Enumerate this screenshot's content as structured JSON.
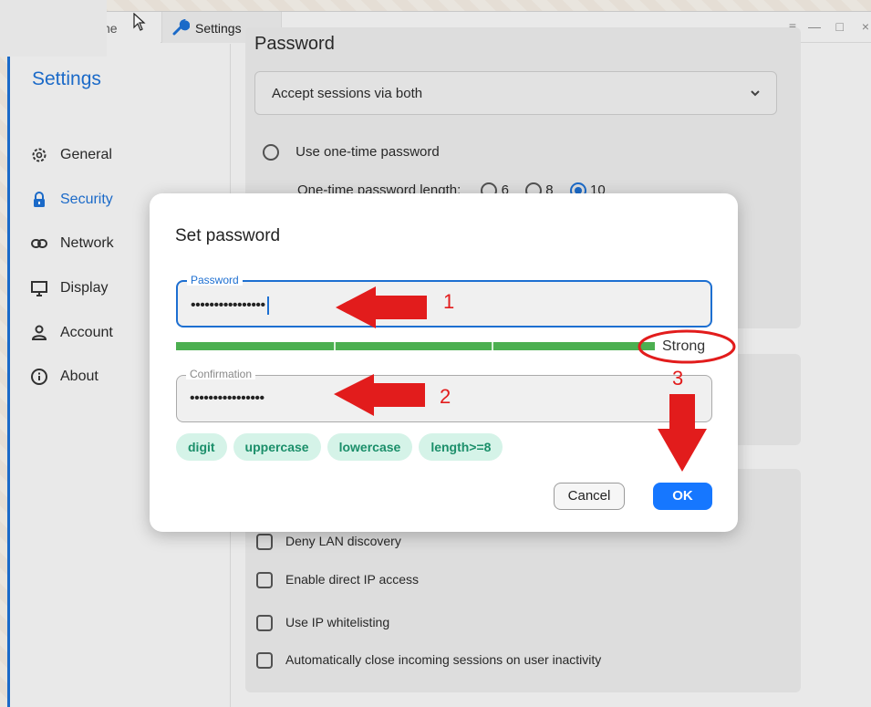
{
  "titlebar": {
    "prev_tab_label": "ne",
    "tab_label": "Settings",
    "controls": {
      "menu": "≡",
      "minimize": "—",
      "maximize": "□",
      "close": "×"
    }
  },
  "sidebar": {
    "title": "Settings",
    "items": [
      {
        "label": "General",
        "icon": "gear-icon"
      },
      {
        "label": "Security",
        "icon": "lock-icon"
      },
      {
        "label": "Network",
        "icon": "link-icon"
      },
      {
        "label": "Display",
        "icon": "monitor-icon"
      },
      {
        "label": "Account",
        "icon": "person-icon"
      },
      {
        "label": "About",
        "icon": "info-icon"
      }
    ],
    "active": "Security"
  },
  "main": {
    "password_section_title": "Password",
    "sessions_select": "Accept sessions via both",
    "use_otp_label": "Use one-time password",
    "otp_length_label": "One-time password length:",
    "otp_options": [
      "6",
      "8",
      "10"
    ],
    "otp_selected": "10",
    "checkboxes": [
      "Deny LAN discovery",
      "Enable direct IP access",
      "Use IP whitelisting",
      "Automatically close incoming sessions on user inactivity"
    ]
  },
  "dialog": {
    "title": "Set password",
    "password_legend": "Password",
    "password_value": "••••••••••••••••",
    "strength_label": "Strength: Strong",
    "strength_text": "Strong",
    "confirmation_legend": "Confirmation",
    "confirmation_value": "••••••••••••••••",
    "requirements": [
      "digit",
      "uppercase",
      "lowercase",
      "length>=8"
    ],
    "cancel_label": "Cancel",
    "ok_label": "OK"
  },
  "annotations": {
    "step1": "1",
    "step2": "2",
    "step3": "3",
    "color": "#e21c1c"
  },
  "colors": {
    "accent": "#1d6fd1",
    "ok_button": "#1677ff",
    "strength_bar": "#4caf50",
    "chip_bg": "#d5f3e8",
    "chip_text": "#1b8f6a"
  }
}
